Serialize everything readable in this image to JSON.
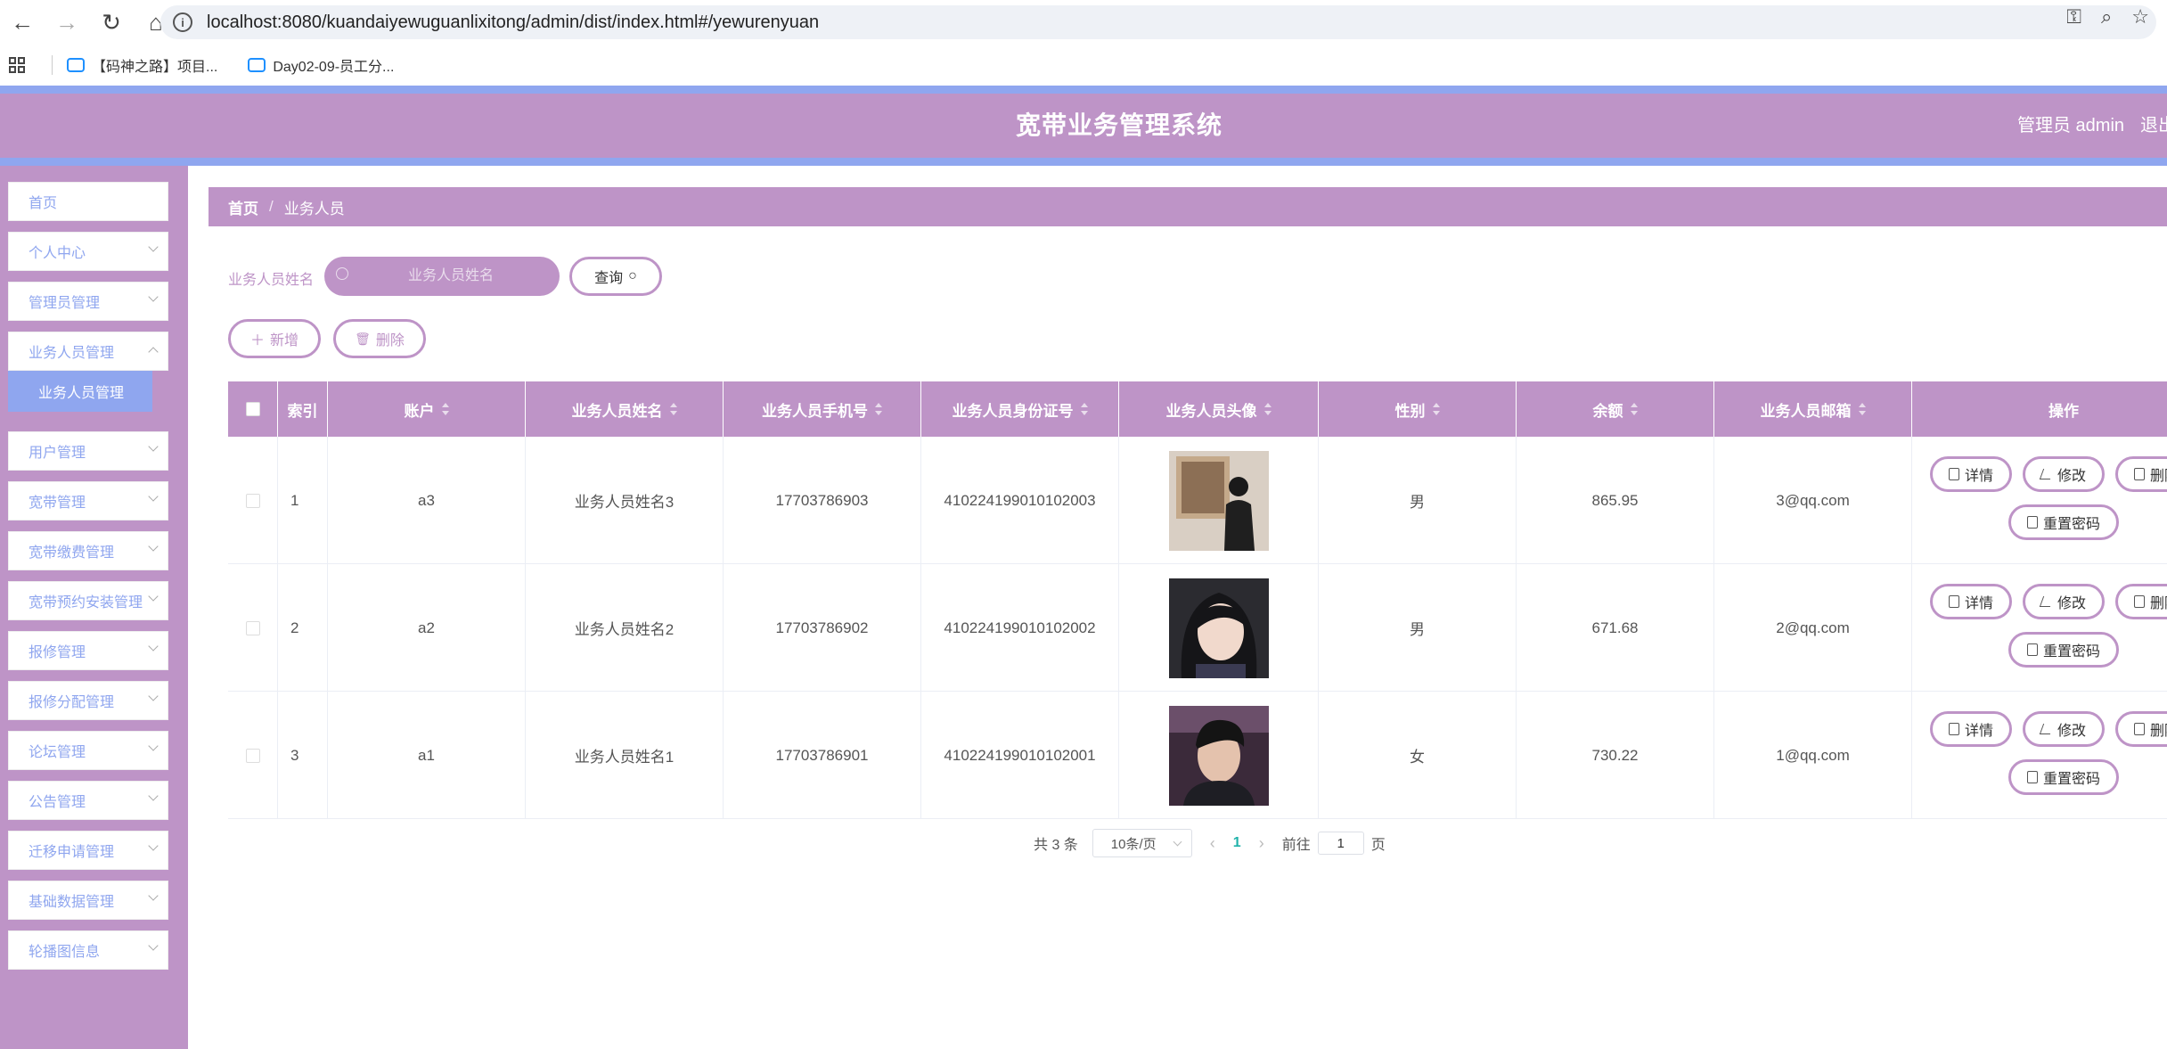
{
  "browser": {
    "url": "localhost:8080/kuandaiyewuguanlixitong/admin/dist/index.html#/yewurenyuan",
    "bookmarks": [
      "【码神之路】项目...",
      "Day02-09-员工分..."
    ]
  },
  "header": {
    "title": "宽带业务管理系统",
    "admin": "管理员 admin",
    "logout": "退出登录"
  },
  "colors": {
    "primary": "#be94c7",
    "accent": "#8fa6ef"
  },
  "sidebar": {
    "items": [
      {
        "label": "首页"
      },
      {
        "label": "个人中心"
      },
      {
        "label": "管理员管理"
      },
      {
        "label": "业务人员管理"
      },
      {
        "label": "用户管理"
      },
      {
        "label": "宽带管理"
      },
      {
        "label": "宽带缴费管理"
      },
      {
        "label": "宽带预约安装管理"
      },
      {
        "label": "报修管理"
      },
      {
        "label": "报修分配管理"
      },
      {
        "label": "论坛管理"
      },
      {
        "label": "公告管理"
      },
      {
        "label": "迁移申请管理"
      },
      {
        "label": "基础数据管理"
      },
      {
        "label": "轮播图信息"
      }
    ],
    "active_sub": "业务人员管理"
  },
  "breadcrumb": {
    "home": "首页",
    "sep": "/",
    "current": "业务人员"
  },
  "search": {
    "label": "业务人员姓名",
    "placeholder": "业务人员姓名",
    "button": "查询"
  },
  "toolbar": {
    "add": "新增",
    "delete": "删除"
  },
  "table": {
    "columns": [
      "索引",
      "账户",
      "业务人员姓名",
      "业务人员手机号",
      "业务人员身份证号",
      "业务人员头像",
      "性别",
      "余额",
      "业务人员邮箱",
      "操作"
    ],
    "rows": [
      {
        "index": "1",
        "account": "a3",
        "name": "业务人员姓名3",
        "phone": "17703786903",
        "id_card": "410224199010102003",
        "gender": "男",
        "balance": "865.95",
        "email": "3@qq.com"
      },
      {
        "index": "2",
        "account": "a2",
        "name": "业务人员姓名2",
        "phone": "17703786902",
        "id_card": "410224199010102002",
        "gender": "男",
        "balance": "671.68",
        "email": "2@qq.com"
      },
      {
        "index": "3",
        "account": "a1",
        "name": "业务人员姓名1",
        "phone": "17703786901",
        "id_card": "410224199010102001",
        "gender": "女",
        "balance": "730.22",
        "email": "1@qq.com"
      }
    ],
    "actions": {
      "detail": "详情",
      "edit": "修改",
      "delete": "删除",
      "reset": "重置密码"
    }
  },
  "pagination": {
    "total": "共 3 条",
    "page_size": "10条/页",
    "current": "1",
    "goto_prefix": "前往",
    "goto_value": "1",
    "goto_suffix": "页"
  }
}
